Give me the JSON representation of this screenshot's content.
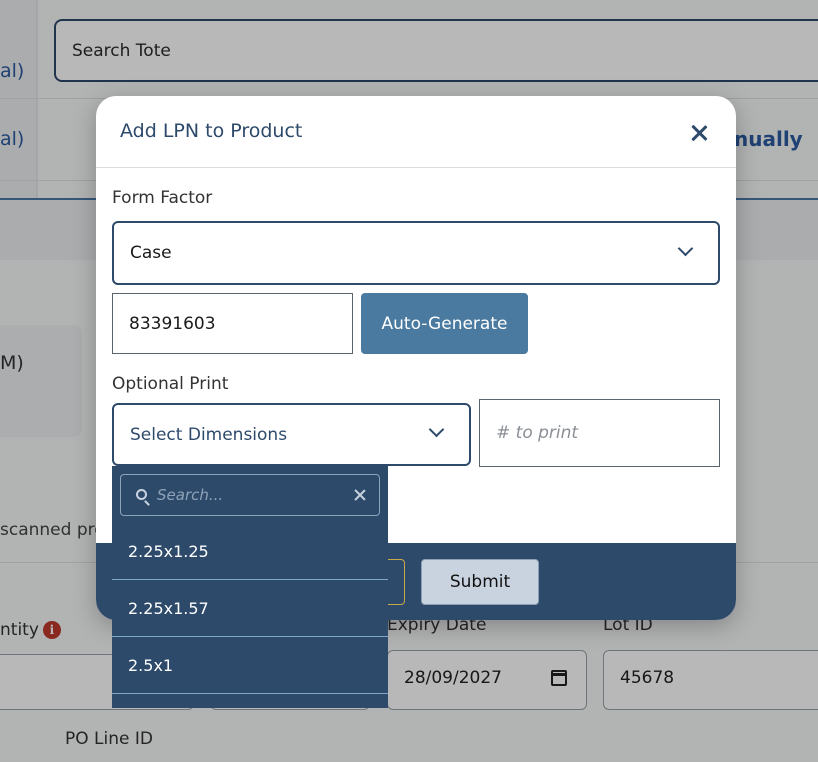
{
  "background": {
    "left_link_1": "al)",
    "left_link_2": "al)",
    "search_placeholder": "Search Tote",
    "right_link": "nually",
    "card_text": "M)",
    "scanned_text": "scanned pro",
    "quantity_label": "ntity",
    "info_icon": "i",
    "expiry_label": "Expiry Date",
    "expiry_value": "28/09/2027",
    "lot_label": "Lot ID",
    "lot_value": "45678",
    "po_line_label": "PO Line ID"
  },
  "modal": {
    "title": "Add LPN to Product",
    "form_factor_label": "Form Factor",
    "form_factor_value": "Case",
    "lpn_value": "83391603",
    "auto_generate_label": "Auto-Generate",
    "optional_print_label": "Optional Print",
    "dimensions_placeholder": "Select Dimensions",
    "print_count_placeholder": "# to print",
    "submit_label": "Submit"
  },
  "dropdown": {
    "search_placeholder": "Search...",
    "options": [
      "2.25x1.25",
      "2.25x1.57",
      "2.5x1"
    ]
  },
  "colors": {
    "primary": "#2d4a6b",
    "button": "#4a7a9f",
    "alert": "#c0392b"
  }
}
